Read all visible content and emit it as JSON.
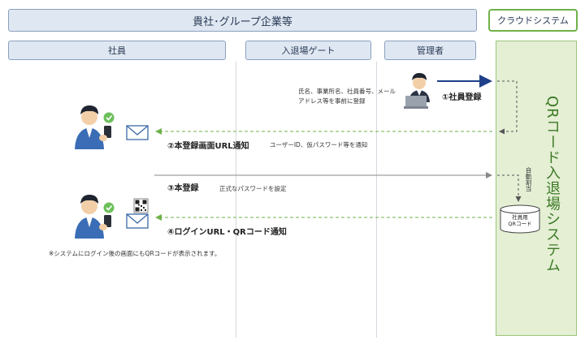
{
  "header": {
    "company": "貴社･グループ企業等",
    "cloud": "クラウドシステム"
  },
  "lanes": {
    "employee": "社員",
    "gate": "入退場ゲート",
    "admin": "管理者"
  },
  "system": {
    "label": "QRコード入退場システム",
    "auto_assign": "自動割当",
    "db_label": "社員用\nQRコード"
  },
  "steps": {
    "step1_label": "①社員登録",
    "step1_note_line1": "氏名、事業所名、社員番号、メール",
    "step1_note_line2": "アドレス等を事前に登録",
    "step2_label": "②本登録画面URL通知",
    "step2_note": "ユーザーID、仮パスワード等を通知",
    "step3_label": "③本登録",
    "step3_note": "正式なパスワードを設定",
    "step4_label": "④ログインURL・QRコード通知"
  },
  "footnote": "※システムにログイン後の画面にもQRコードが表示されます。",
  "colors": {
    "header_fill": "#dfe7f2",
    "cloud_border": "#6fb24a",
    "system_fill": "#e4efd4",
    "system_text": "#3d7a26",
    "arrow_dashed": "#6fb24a",
    "arrow_solid_admin": "#1f3f8a",
    "arrow_gray": "#888888"
  },
  "icons": {
    "employee_person": "person-with-phone-icon",
    "admin_person": "person-at-laptop-icon",
    "mail": "envelope-icon",
    "qr": "qr-code-icon",
    "check": "check-circle-icon",
    "database": "database-icon"
  }
}
